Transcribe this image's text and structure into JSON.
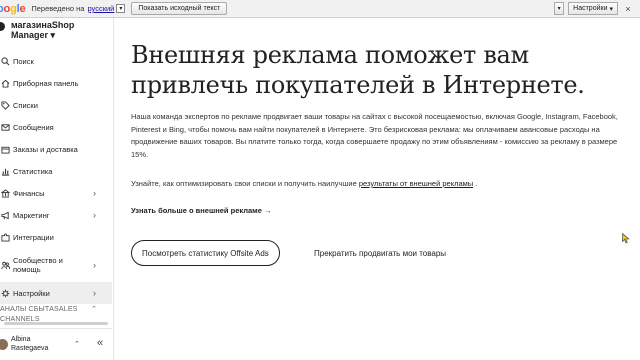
{
  "translate_bar": {
    "logo": "oogle",
    "translated_to": "Переведено на",
    "language": "русский",
    "show_original": "Показать исходный текст",
    "settings": "Настройки"
  },
  "sidebar": {
    "shop_name": "магазинаShop",
    "shop_sub": "Manager ▾",
    "items": [
      {
        "label": "Поиск",
        "icon": "search-icon"
      },
      {
        "label": "Приборная панель",
        "icon": "home-icon"
      },
      {
        "label": "Списки",
        "icon": "tag-icon"
      },
      {
        "label": "Сообщения",
        "icon": "mail-icon"
      },
      {
        "label": "Заказы и доставка",
        "icon": "box-icon"
      },
      {
        "label": "Статистика",
        "icon": "chart-icon"
      },
      {
        "label": "Финансы",
        "icon": "bank-icon"
      },
      {
        "label": "Маркетинг",
        "icon": "megaphone-icon"
      },
      {
        "label": "Интеграции",
        "icon": "puzzle-icon"
      },
      {
        "label": "Сообщество и помощь",
        "icon": "people-icon"
      },
      {
        "label": "Настройки",
        "icon": "gear-icon"
      }
    ],
    "channels_label": "АНАЛЫ СБЫТАSALES CHANNELS",
    "user_first": "Albina",
    "user_last": "Rastegaeva"
  },
  "main": {
    "headline": "Внешняя реклама поможет вам привлечь покупателей в Интернете.",
    "description": "Наша команда экспертов по рекламе продвигает ваши товары на сайтах с высокой посещаемостью, включая Google, Instagram, Facebook, Pinterest и Bing, чтобы помочь вам найти покупателей в Интернете. Это безрисковая реклама: мы оплачиваем авансовые расходы на продвижение ваших товаров. Вы платите только тогда, когда совершаете продажу по этим объявлениям - комиссию за рекламу в размере 15%.",
    "learn_prefix": "Узнайте, как оптимизировать свои списки и получить наилучшие",
    "learn_link": "результаты от внешней рекламы",
    "learn_suffix": ".",
    "more_link": "Узнать больше о внешней рекламе →",
    "stats_button": "Посмотреть статистику Offsite Ads",
    "stop_button": "Прекратить продвигать мои товары"
  }
}
